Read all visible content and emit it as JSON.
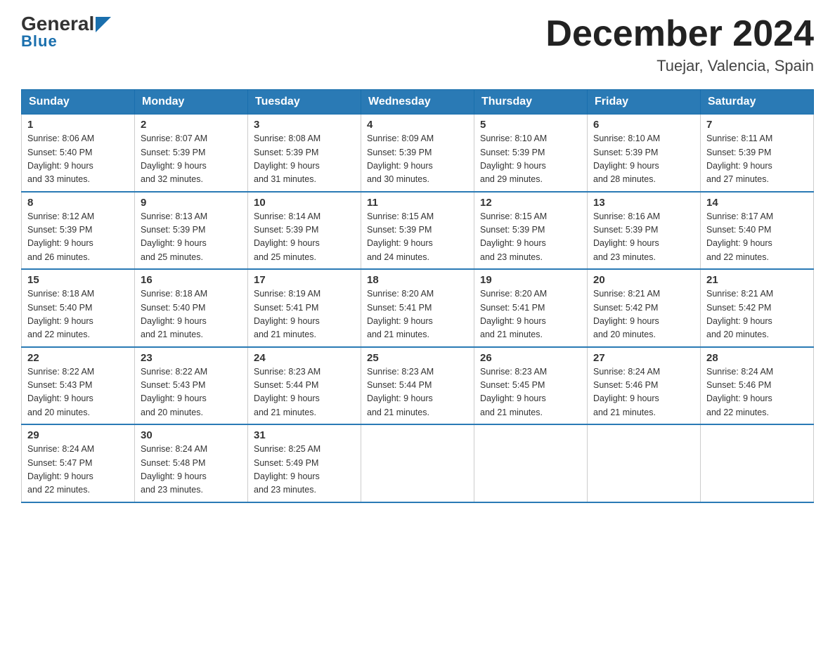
{
  "header": {
    "logo_general": "General",
    "logo_blue": "Blue",
    "month_title": "December 2024",
    "location": "Tuejar, Valencia, Spain"
  },
  "days_of_week": [
    "Sunday",
    "Monday",
    "Tuesday",
    "Wednesday",
    "Thursday",
    "Friday",
    "Saturday"
  ],
  "weeks": [
    [
      {
        "day": "1",
        "sunrise": "8:06 AM",
        "sunset": "5:40 PM",
        "daylight": "9 hours and 33 minutes."
      },
      {
        "day": "2",
        "sunrise": "8:07 AM",
        "sunset": "5:39 PM",
        "daylight": "9 hours and 32 minutes."
      },
      {
        "day": "3",
        "sunrise": "8:08 AM",
        "sunset": "5:39 PM",
        "daylight": "9 hours and 31 minutes."
      },
      {
        "day": "4",
        "sunrise": "8:09 AM",
        "sunset": "5:39 PM",
        "daylight": "9 hours and 30 minutes."
      },
      {
        "day": "5",
        "sunrise": "8:10 AM",
        "sunset": "5:39 PM",
        "daylight": "9 hours and 29 minutes."
      },
      {
        "day": "6",
        "sunrise": "8:10 AM",
        "sunset": "5:39 PM",
        "daylight": "9 hours and 28 minutes."
      },
      {
        "day": "7",
        "sunrise": "8:11 AM",
        "sunset": "5:39 PM",
        "daylight": "9 hours and 27 minutes."
      }
    ],
    [
      {
        "day": "8",
        "sunrise": "8:12 AM",
        "sunset": "5:39 PM",
        "daylight": "9 hours and 26 minutes."
      },
      {
        "day": "9",
        "sunrise": "8:13 AM",
        "sunset": "5:39 PM",
        "daylight": "9 hours and 25 minutes."
      },
      {
        "day": "10",
        "sunrise": "8:14 AM",
        "sunset": "5:39 PM",
        "daylight": "9 hours and 25 minutes."
      },
      {
        "day": "11",
        "sunrise": "8:15 AM",
        "sunset": "5:39 PM",
        "daylight": "9 hours and 24 minutes."
      },
      {
        "day": "12",
        "sunrise": "8:15 AM",
        "sunset": "5:39 PM",
        "daylight": "9 hours and 23 minutes."
      },
      {
        "day": "13",
        "sunrise": "8:16 AM",
        "sunset": "5:39 PM",
        "daylight": "9 hours and 23 minutes."
      },
      {
        "day": "14",
        "sunrise": "8:17 AM",
        "sunset": "5:40 PM",
        "daylight": "9 hours and 22 minutes."
      }
    ],
    [
      {
        "day": "15",
        "sunrise": "8:18 AM",
        "sunset": "5:40 PM",
        "daylight": "9 hours and 22 minutes."
      },
      {
        "day": "16",
        "sunrise": "8:18 AM",
        "sunset": "5:40 PM",
        "daylight": "9 hours and 21 minutes."
      },
      {
        "day": "17",
        "sunrise": "8:19 AM",
        "sunset": "5:41 PM",
        "daylight": "9 hours and 21 minutes."
      },
      {
        "day": "18",
        "sunrise": "8:20 AM",
        "sunset": "5:41 PM",
        "daylight": "9 hours and 21 minutes."
      },
      {
        "day": "19",
        "sunrise": "8:20 AM",
        "sunset": "5:41 PM",
        "daylight": "9 hours and 21 minutes."
      },
      {
        "day": "20",
        "sunrise": "8:21 AM",
        "sunset": "5:42 PM",
        "daylight": "9 hours and 20 minutes."
      },
      {
        "day": "21",
        "sunrise": "8:21 AM",
        "sunset": "5:42 PM",
        "daylight": "9 hours and 20 minutes."
      }
    ],
    [
      {
        "day": "22",
        "sunrise": "8:22 AM",
        "sunset": "5:43 PM",
        "daylight": "9 hours and 20 minutes."
      },
      {
        "day": "23",
        "sunrise": "8:22 AM",
        "sunset": "5:43 PM",
        "daylight": "9 hours and 20 minutes."
      },
      {
        "day": "24",
        "sunrise": "8:23 AM",
        "sunset": "5:44 PM",
        "daylight": "9 hours and 21 minutes."
      },
      {
        "day": "25",
        "sunrise": "8:23 AM",
        "sunset": "5:44 PM",
        "daylight": "9 hours and 21 minutes."
      },
      {
        "day": "26",
        "sunrise": "8:23 AM",
        "sunset": "5:45 PM",
        "daylight": "9 hours and 21 minutes."
      },
      {
        "day": "27",
        "sunrise": "8:24 AM",
        "sunset": "5:46 PM",
        "daylight": "9 hours and 21 minutes."
      },
      {
        "day": "28",
        "sunrise": "8:24 AM",
        "sunset": "5:46 PM",
        "daylight": "9 hours and 22 minutes."
      }
    ],
    [
      {
        "day": "29",
        "sunrise": "8:24 AM",
        "sunset": "5:47 PM",
        "daylight": "9 hours and 22 minutes."
      },
      {
        "day": "30",
        "sunrise": "8:24 AM",
        "sunset": "5:48 PM",
        "daylight": "9 hours and 23 minutes."
      },
      {
        "day": "31",
        "sunrise": "8:25 AM",
        "sunset": "5:49 PM",
        "daylight": "9 hours and 23 minutes."
      },
      null,
      null,
      null,
      null
    ]
  ],
  "labels": {
    "sunrise": "Sunrise:",
    "sunset": "Sunset:",
    "daylight": "Daylight:"
  }
}
